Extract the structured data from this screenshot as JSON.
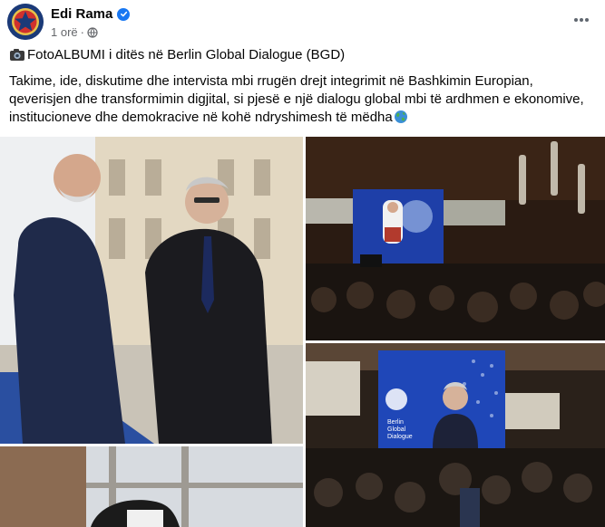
{
  "post": {
    "author": "Edi Rama",
    "time": "1 orë",
    "title": "FotoALBUMI i ditës në Berlin Global Dialogue (BGD)",
    "text": "Takime, ide, diskutime dhe intervista mbi rrugën drejt integrimit në Bashkimin Europian, qeverisjen dhe transformimin digjital, si pjesë e një dialogu global mbi të ardhmen e ekonomive, institucioneve dhe demokracive në kohë ndryshimesh të mëdha"
  },
  "photos": {
    "screen_caption": "Berlin Global Dialogue"
  },
  "colors": {
    "verified": "#1877f2",
    "meta_text": "#65676b",
    "stage_screen": "#1e3fa8"
  },
  "icons": [
    "star-emblem-icon",
    "verified-badge-icon",
    "globe-icon",
    "more-options-icon",
    "camera-icon",
    "earth-emoji-icon"
  ]
}
